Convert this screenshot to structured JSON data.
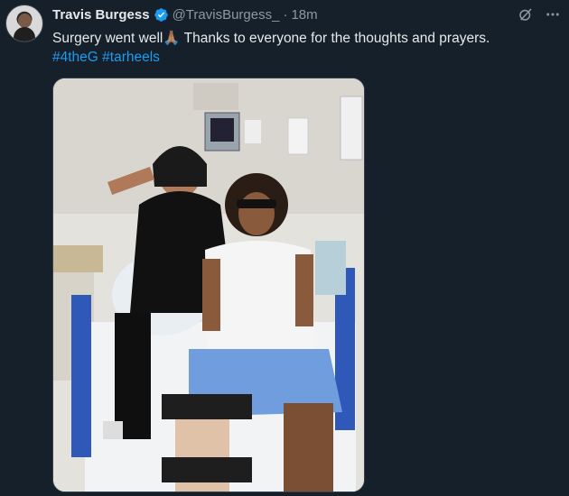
{
  "tweet": {
    "display_name": "Travis Burgess",
    "handle": "@TravisBurgess_",
    "separator": "·",
    "time": "18m",
    "text_main": "Surgery went well",
    "emoji": "🙏🏽",
    "text_rest": " Thanks to everyone for the thoughts and prayers.",
    "hashtags": "#4theG #tarheels"
  },
  "icons": {
    "verified": "verified-badge-icon",
    "grok": "grok-icon",
    "more": "more-icon"
  },
  "colors": {
    "background": "#15202b",
    "link": "#1d9bf0",
    "secondary": "#8b98a5",
    "verified": "#1d9bf0"
  }
}
